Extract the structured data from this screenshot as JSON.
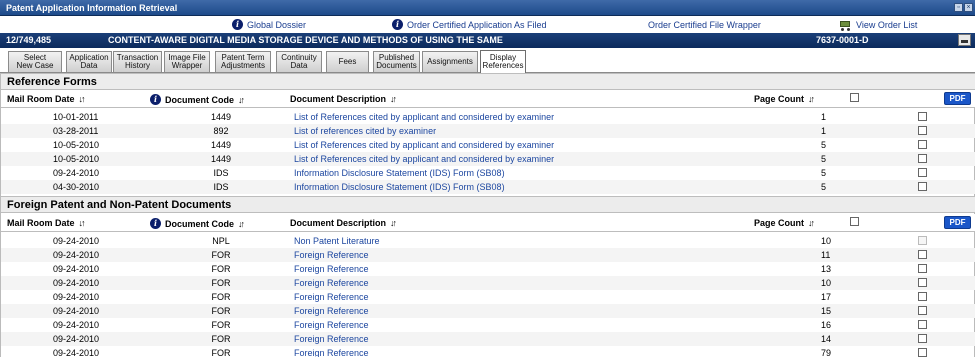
{
  "window": {
    "title": "Patent Application Information Retrieval"
  },
  "links": [
    {
      "label": "Global Dossier",
      "icon": "info-icon"
    },
    {
      "label": "Order Certified Application As Filed",
      "icon": "info-icon"
    },
    {
      "label": "Order Certified File Wrapper",
      "icon": ""
    },
    {
      "label": "View Order List",
      "icon": "cart-icon"
    }
  ],
  "case": {
    "application_number": "12/749,485",
    "title": "CONTENT-AWARE DIGITAL MEDIA STORAGE DEVICE AND METHODS OF USING THE SAME",
    "docket": "7637-0001-D"
  },
  "tabs": [
    {
      "label": "Select\nNew Case"
    },
    {
      "label": "Application\nData"
    },
    {
      "label": "Transaction\nHistory"
    },
    {
      "label": "Image File\nWrapper"
    },
    {
      "label": "Patent Term\nAdjustments"
    },
    {
      "label": "Continuity\nData"
    },
    {
      "label": "Fees"
    },
    {
      "label": "Published\nDocuments"
    },
    {
      "label": "Assignments"
    },
    {
      "label": "Display\nReferences"
    }
  ],
  "columns": {
    "mail_room_date": "Mail Room Date",
    "document_code": "Document Code",
    "document_description": "Document Description",
    "page_count": "Page Count",
    "pdf": "PDF"
  },
  "reference_forms": {
    "title": "Reference Forms",
    "rows": [
      {
        "date": "10-01-2011",
        "code": "1449",
        "desc": "List of References cited by applicant and considered by examiner",
        "pages": "1"
      },
      {
        "date": "03-28-2011",
        "code": "892",
        "desc": "List of references cited by examiner",
        "pages": "1"
      },
      {
        "date": "10-05-2010",
        "code": "1449",
        "desc": "List of References cited by applicant and considered by examiner",
        "pages": "5"
      },
      {
        "date": "10-05-2010",
        "code": "1449",
        "desc": "List of References cited by applicant and considered by examiner",
        "pages": "5"
      },
      {
        "date": "09-24-2010",
        "code": "IDS",
        "desc": "Information Disclosure Statement (IDS) Form (SB08)",
        "pages": "5"
      },
      {
        "date": "04-30-2010",
        "code": "IDS",
        "desc": "Information Disclosure Statement (IDS) Form (SB08)",
        "pages": "5"
      }
    ]
  },
  "foreign_docs": {
    "title": "Foreign Patent and Non-Patent Documents",
    "rows": [
      {
        "date": "09-24-2010",
        "code": "NPL",
        "desc": "Non Patent Literature",
        "pages": "10",
        "disabled": true
      },
      {
        "date": "09-24-2010",
        "code": "FOR",
        "desc": "Foreign Reference",
        "pages": "11"
      },
      {
        "date": "09-24-2010",
        "code": "FOR",
        "desc": "Foreign Reference",
        "pages": "13"
      },
      {
        "date": "09-24-2010",
        "code": "FOR",
        "desc": "Foreign Reference",
        "pages": "10"
      },
      {
        "date": "09-24-2010",
        "code": "FOR",
        "desc": "Foreign Reference",
        "pages": "17"
      },
      {
        "date": "09-24-2010",
        "code": "FOR",
        "desc": "Foreign Reference",
        "pages": "15"
      },
      {
        "date": "09-24-2010",
        "code": "FOR",
        "desc": "Foreign Reference",
        "pages": "16"
      },
      {
        "date": "09-24-2010",
        "code": "FOR",
        "desc": "Foreign Reference",
        "pages": "14"
      },
      {
        "date": "09-24-2010",
        "code": "FOR",
        "desc": "Foreign Reference",
        "pages": "79"
      }
    ]
  }
}
